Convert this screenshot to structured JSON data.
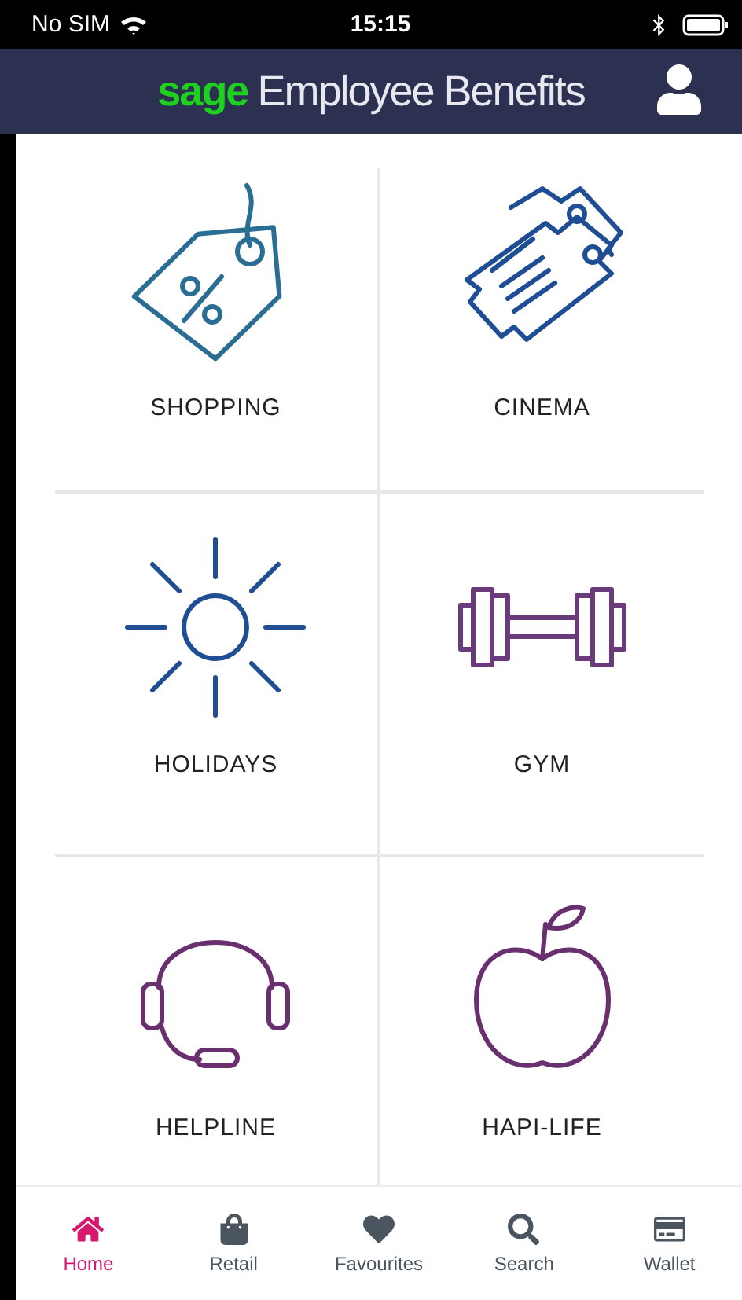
{
  "status_bar": {
    "carrier": "No SIM",
    "time": "15:15"
  },
  "header": {
    "brand": "sage",
    "title": "Employee Benefits"
  },
  "tiles": [
    {
      "label": "SHOPPING",
      "kind": "tag",
      "color": "#2a6e94"
    },
    {
      "label": "CINEMA",
      "kind": "tickets",
      "color": "#1f4e94"
    },
    {
      "label": "HOLIDAYS",
      "kind": "sun",
      "color": "#1f4e94"
    },
    {
      "label": "GYM",
      "kind": "dumbbell",
      "color": "#6a3a7a"
    },
    {
      "label": "HELPLINE",
      "kind": "headset",
      "color": "#6a2f6f"
    },
    {
      "label": "HAPI-LIFE",
      "kind": "apple",
      "color": "#6a2f6f"
    }
  ],
  "tab_bar": [
    {
      "label": "Home",
      "kind": "home",
      "selected": true
    },
    {
      "label": "Retail",
      "kind": "bag",
      "selected": false
    },
    {
      "label": "Favourites",
      "kind": "heart",
      "selected": false
    },
    {
      "label": "Search",
      "kind": "search",
      "selected": false
    },
    {
      "label": "Wallet",
      "kind": "card",
      "selected": false
    }
  ]
}
